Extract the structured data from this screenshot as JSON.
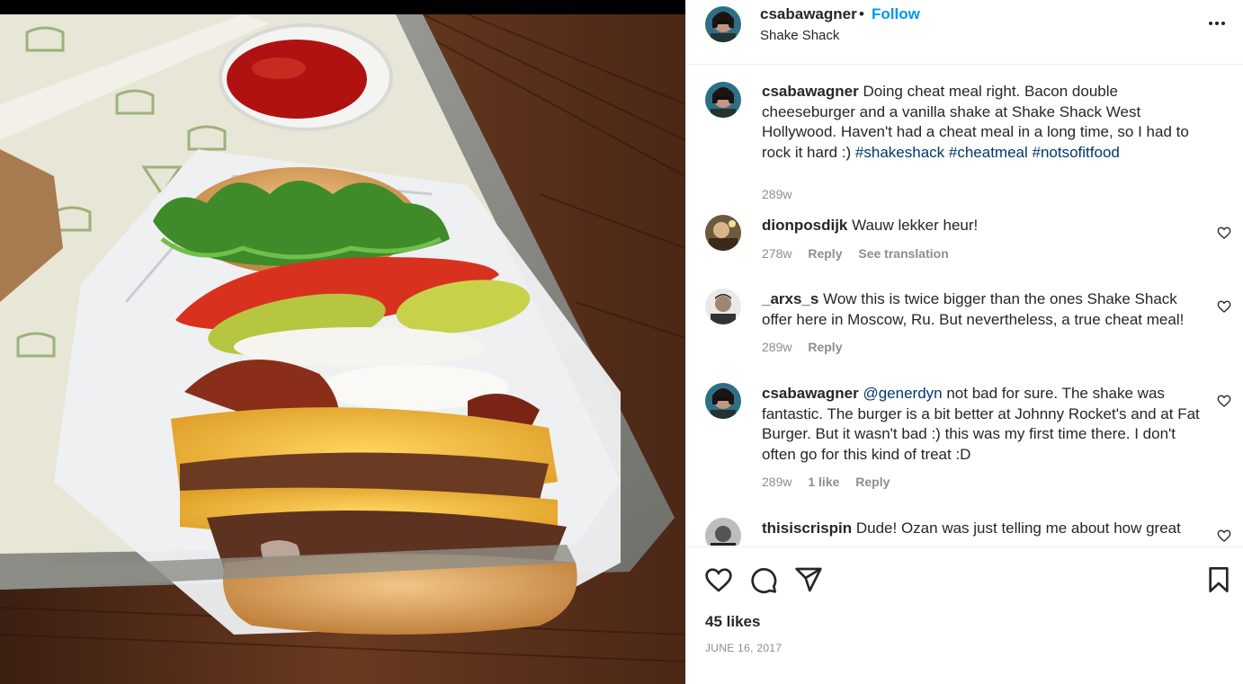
{
  "post": {
    "username": "csabawagner",
    "dot": "•",
    "follow_label": "Follow",
    "location": "Shake Shack",
    "more_icon": "more-horizontal-icon"
  },
  "caption": {
    "username": "csabawagner",
    "text": "Doing cheat meal right. Bacon double cheeseburger and a vanilla shake at Shake Shack West Hollywood. Haven't had a cheat meal in a long time, so I had to rock it hard :) ",
    "hashtags": [
      "#shakeshack",
      "#cheatmeal",
      "#notsofitfood"
    ],
    "age": "289w"
  },
  "comments": [
    {
      "username": "dionposdijk",
      "text": "Wauw lekker heur!",
      "age": "278w",
      "reply_label": "Reply",
      "translate_label": "See translation"
    },
    {
      "username": "_arxs_s",
      "text": "Wow this is twice bigger than the ones Shake Shack offer here in Moscow, Ru. But nevertheless, a true cheat meal!",
      "age": "289w",
      "reply_label": "Reply"
    },
    {
      "username": "csabawagner",
      "mention": "@generdyn",
      "text": " not bad for sure. The shake was fantastic. The burger is a bit better at Johnny Rocket's and at Fat Burger. But it wasn't bad :) this was my first time there. I don't often go for this kind of treat :D",
      "age": "289w",
      "likes_label": "1 like",
      "reply_label": "Reply"
    },
    {
      "username": "thisiscrispin",
      "text": "Dude! Ozan was just telling me about how great"
    }
  ],
  "footer": {
    "likes": "45 likes",
    "date": "JUNE 16, 2017"
  },
  "colors": {
    "link_blue": "#0095f6",
    "hashtag": "#00376b",
    "muted": "#8e8e8e",
    "text": "#262626"
  }
}
